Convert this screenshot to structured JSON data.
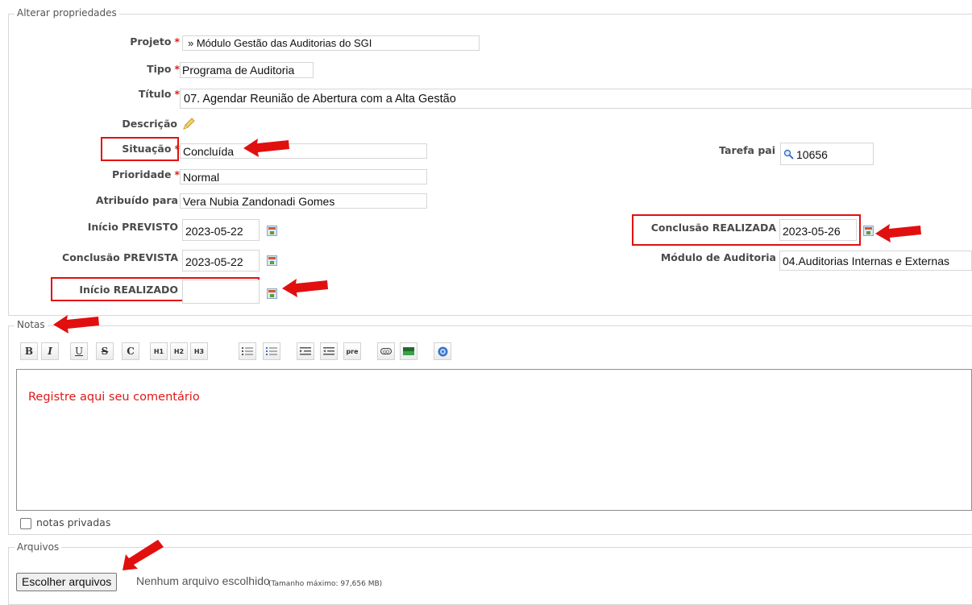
{
  "properties": {
    "legend": "Alterar propriedades",
    "projeto_label": "Projeto",
    "projeto_value": "» Módulo Gestão das Auditorias do SGI",
    "tipo_label": "Tipo",
    "tipo_value": "Programa de Auditoria",
    "titulo_label": "Título",
    "titulo_value": "07. Agendar Reunião de Abertura com a Alta Gestão",
    "descricao_label": "Descrição",
    "situacao_label": "Situação",
    "situacao_value": "Concluída",
    "prioridade_label": "Prioridade",
    "prioridade_value": "Normal",
    "atribuido_label": "Atribuído para",
    "atribuido_value": "Vera Nubia Zandonadi Gomes",
    "inicio_previsto_label": "Início PREVISTO",
    "inicio_previsto_value": "2023-05-22",
    "conclusao_prevista_label": "Conclusão PREVISTA",
    "conclusao_prevista_value": "2023-05-22",
    "inicio_realizado_label": "Início REALIZADO",
    "inicio_realizado_value": "",
    "tarefa_pai_label": "Tarefa pai",
    "tarefa_pai_value": "10656",
    "conclusao_realizada_label": "Conclusão REALIZADA",
    "conclusao_realizada_value": "2023-05-26",
    "modulo_label": "Módulo de Auditoria",
    "modulo_value": "04.Auditorias Internas e Externas",
    "required_mark": "*"
  },
  "notes": {
    "legend": "Notas",
    "toolbar": [
      "B",
      "I",
      "U",
      "S",
      "C",
      "H1",
      "H2",
      "H3",
      "ul",
      "ol",
      "outdent",
      "indent",
      "pre",
      "link",
      "image",
      "help"
    ],
    "comment_text": "Registre aqui seu comentário",
    "private_label": "notas privadas"
  },
  "files": {
    "legend": "Arquivos",
    "choose_button": "Escolher arquivos",
    "no_file": "Nenhum arquivo escolhido",
    "max_size": "(Tamanho máximo: 97,656 MB)"
  },
  "colors": {
    "annotation_red": "#e20f0f",
    "required_red": "#d9201a"
  }
}
